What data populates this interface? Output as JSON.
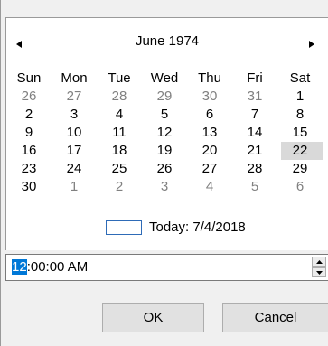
{
  "calendar": {
    "month_title": "June 1974",
    "prev_icon": "triangle-left-icon",
    "next_icon": "triangle-right-icon",
    "day_names": [
      "Sun",
      "Mon",
      "Tue",
      "Wed",
      "Thu",
      "Fri",
      "Sat"
    ],
    "weeks": [
      [
        "26",
        "27",
        "28",
        "29",
        "30",
        "31",
        "1"
      ],
      [
        "2",
        "3",
        "4",
        "5",
        "6",
        "7",
        "8"
      ],
      [
        "9",
        "10",
        "11",
        "12",
        "13",
        "14",
        "15"
      ],
      [
        "16",
        "17",
        "18",
        "19",
        "20",
        "21",
        "22"
      ],
      [
        "23",
        "24",
        "25",
        "26",
        "27",
        "28",
        "29"
      ],
      [
        "30",
        "1",
        "2",
        "3",
        "4",
        "5",
        "6"
      ]
    ],
    "selected_day": "22",
    "today_label": "Today: 7/4/2018"
  },
  "time": {
    "hour_selected": "12",
    "rest": ":00:00 AM",
    "spin_up_icon": "triangle-up-icon",
    "spin_down_icon": "triangle-down-icon"
  },
  "buttons": {
    "ok": "OK",
    "cancel": "Cancel"
  },
  "colors": {
    "selection": "#0078d7",
    "selected_day_bg": "#d9d9d9",
    "other_month_text": "#808080",
    "today_box_border": "#2e6bb7"
  }
}
